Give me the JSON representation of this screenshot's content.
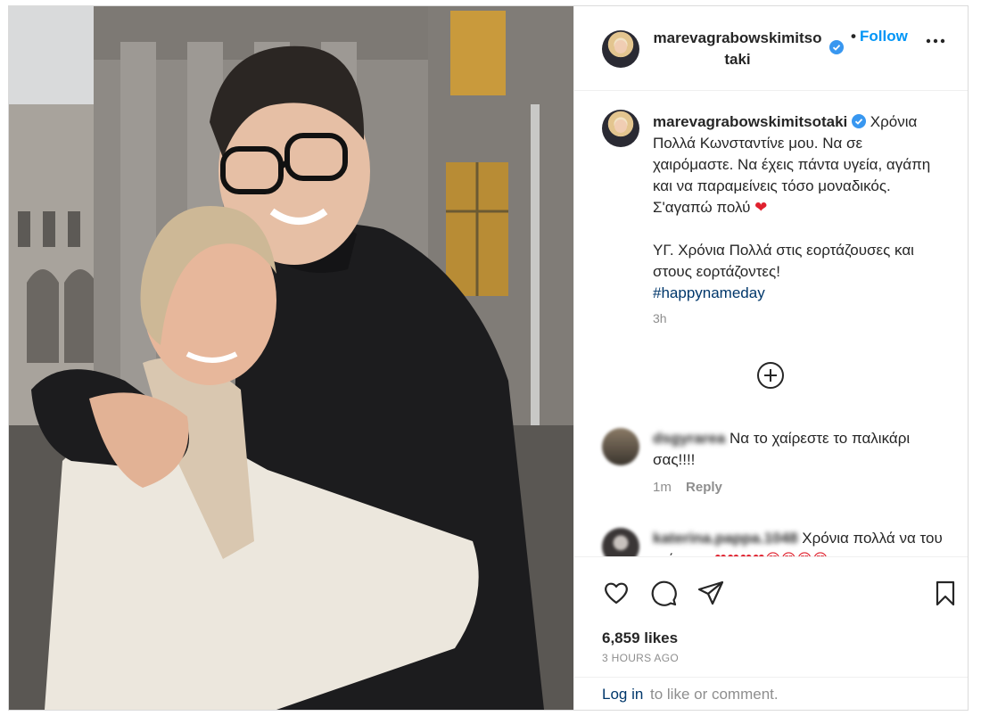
{
  "post": {
    "username": "marevagrabowskimitsotaki",
    "follow_label": "Follow",
    "dot": "•",
    "caption_username": "marevagrabowskimitsotaki",
    "caption_text": "Χρόνια Πολλά Κωνσταντίνε μου. Να σε χαιρόμαστε. Να έχεις πάντα υγεία, αγάπη και να παραμείνεις τόσο μοναδικός. Σ'αγαπώ πολύ",
    "caption_heart": "❤",
    "caption_ps": "ΥΓ. Χρόνια Πολλά στις εορτάζουσες και στους εορτάζοντες!",
    "hashtag": "#happynameday",
    "caption_time": "3h"
  },
  "comments": [
    {
      "username": "dsgyrarea",
      "text": "Να το χαίρεστε το παλικάρι σας!!!!",
      "time": "1m",
      "reply_label": "Reply"
    },
    {
      "username": "katerina.pappa.1048",
      "text": "Χρόνια πολλά να του χαίρεστε",
      "emojis": "❤❤❤❤😍😍😍😍"
    }
  ],
  "footer": {
    "likes": "6,859 likes",
    "ago": "3 HOURS AGO",
    "login_label": "Log in",
    "login_rest": "to like or comment."
  },
  "icons": [
    "verified-badge-icon",
    "more-options-icon",
    "load-more-comments-icon",
    "heart-icon",
    "comment-icon",
    "share-icon",
    "save-icon"
  ],
  "colors": {
    "link_blue": "#0095f6",
    "hashtag_blue": "#00376b",
    "muted": "#8e8e8e",
    "heart_red": "#e0212e"
  }
}
